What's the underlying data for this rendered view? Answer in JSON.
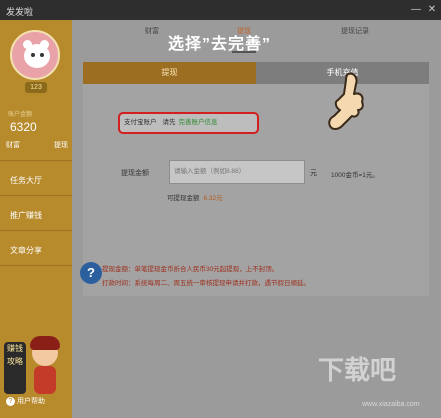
{
  "window": {
    "title": "发发啦",
    "controls": [
      "—",
      "✕"
    ]
  },
  "sidebar": {
    "level": "123",
    "account_label": "账户金额",
    "balance": "6320",
    "links": [
      "财富",
      "提现"
    ],
    "nav": [
      "任务大厅",
      "推广赚钱",
      "文章分享"
    ],
    "promo_badge": "赚钱攻略",
    "help": "用户帮助"
  },
  "tabs": [
    "财富",
    "提现",
    "提现记录"
  ],
  "callout": "选择”去完善”",
  "subtabs": {
    "active": "提现",
    "other": "手机充值"
  },
  "form": {
    "alipay_label": "支付宝账户",
    "please": "请先",
    "complete_link": "完善账户信息",
    "amount_label": "提现金额",
    "amount_placeholder": "请输入金额（例如8.88）",
    "unit": "元",
    "rate": "1000金币=1元。",
    "available_label": "可提现金额",
    "available_amount": "6.32元"
  },
  "notice": {
    "line1": "提现金额：单笔提现金币折合人民币30元起提现，上不封顶。",
    "line2": "打款时间：系统每周二、周五统一审核提现申请并打款，遇节假日顺延。"
  },
  "watermark": {
    "text": "下载吧",
    "url": "www.xiazaiba.com"
  },
  "colors": {
    "sidebar": "#b78a2c",
    "highlight": "#d21f1f",
    "link": "#2e8a2e"
  }
}
